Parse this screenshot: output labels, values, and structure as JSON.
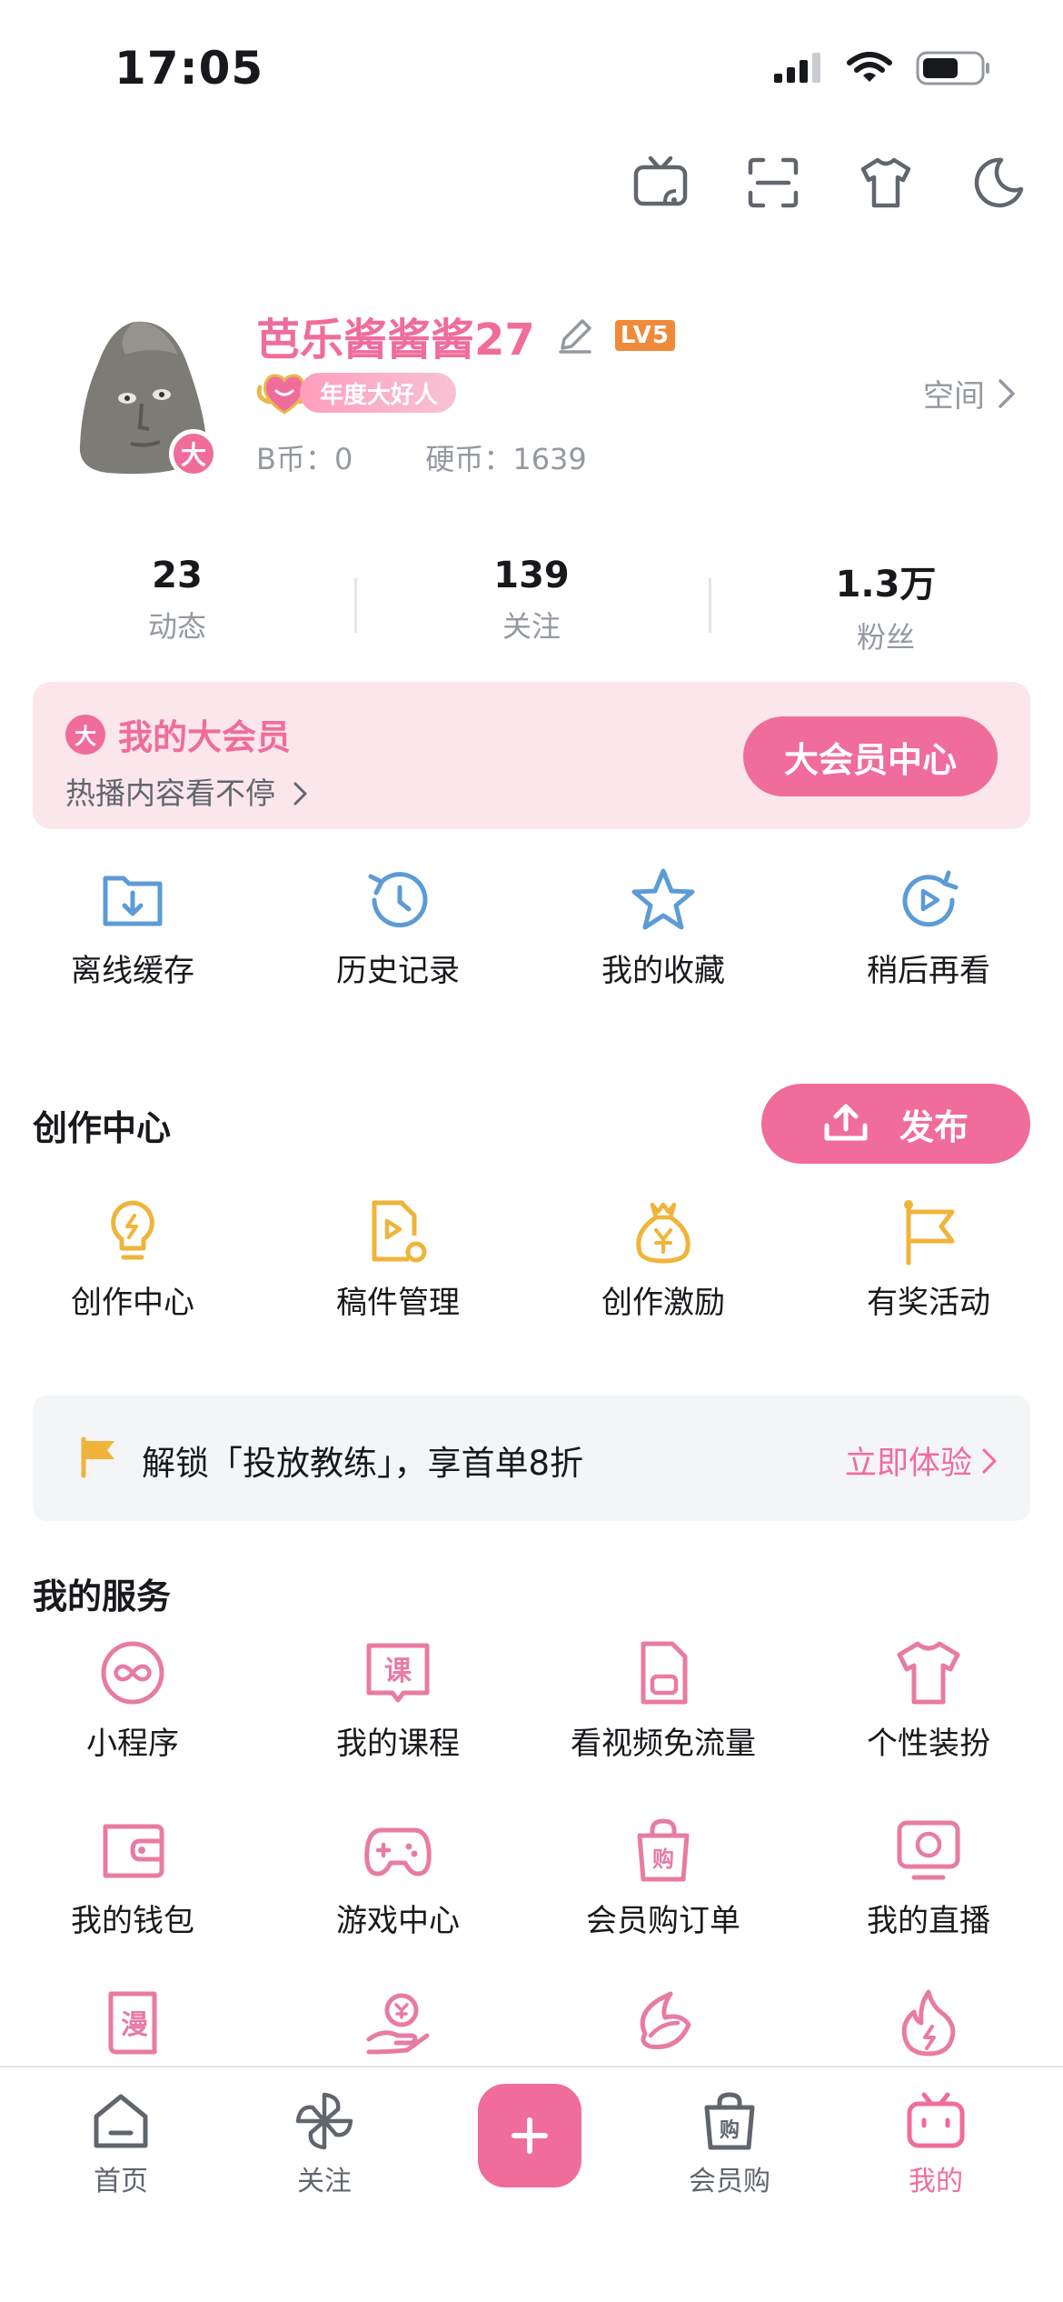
{
  "status_bar": {
    "time": "17:05"
  },
  "top_actions": [
    "tv-cast-icon",
    "scan-icon",
    "dress-up-icon",
    "night-mode-icon"
  ],
  "profile": {
    "nickname": "芭乐酱酱酱27",
    "level": "LV5",
    "badge": "年度大好人",
    "vip_mark": "大",
    "bcoin": "B币：0",
    "coins": "硬币：1639",
    "space_label": "空间"
  },
  "stats": [
    {
      "value": "23",
      "label": "动态"
    },
    {
      "value": "139",
      "label": "关注"
    },
    {
      "value": "1.3万",
      "label": "粉丝"
    }
  ],
  "vip": {
    "logo": "大",
    "title": "我的大会员",
    "subtitle": "热播内容看不停",
    "button": "大会员中心"
  },
  "quick": [
    {
      "label": "离线缓存",
      "icon": "offline-cache-icon"
    },
    {
      "label": "历史记录",
      "icon": "history-icon"
    },
    {
      "label": "我的收藏",
      "icon": "favorites-icon"
    },
    {
      "label": "稍后再看",
      "icon": "watch-later-icon"
    }
  ],
  "creation": {
    "title": "创作中心",
    "publish": "发布",
    "items": [
      {
        "label": "创作中心",
        "icon": "lightbulb-icon"
      },
      {
        "label": "稿件管理",
        "icon": "manuscript-icon"
      },
      {
        "label": "创作激励",
        "icon": "money-bag-icon"
      },
      {
        "label": "有奖活动",
        "icon": "flag-icon"
      }
    ]
  },
  "promo": {
    "text": "解锁「投放教练」，享首单8折",
    "link": "立即体验"
  },
  "services": {
    "title": "我的服务",
    "items": [
      {
        "label": "小程序",
        "icon": "mini-program-icon"
      },
      {
        "label": "我的课程",
        "icon": "course-icon"
      },
      {
        "label": "看视频免流量",
        "icon": "sim-card-icon"
      },
      {
        "label": "个性装扮",
        "icon": "t-shirt-icon"
      },
      {
        "label": "我的钱包",
        "icon": "wallet-icon"
      },
      {
        "label": "游戏中心",
        "icon": "gamepad-icon"
      },
      {
        "label": "会员购订单",
        "icon": "shopping-bag-icon"
      },
      {
        "label": "我的直播",
        "icon": "live-tv-icon"
      }
    ]
  },
  "tabbar": [
    {
      "label": "首页",
      "icon": "home-icon"
    },
    {
      "label": "关注",
      "icon": "pinwheel-icon"
    },
    {
      "label": "",
      "icon": "plus-icon"
    },
    {
      "label": "会员购",
      "icon": "mall-bag-icon"
    },
    {
      "label": "我的",
      "icon": "tv-mascot-icon"
    }
  ],
  "colors": {
    "accent": "#f06c9b",
    "blue_icon": "#5c9bd6",
    "gold_icon": "#f0b43a",
    "pink_icon": "#e87ba3"
  }
}
